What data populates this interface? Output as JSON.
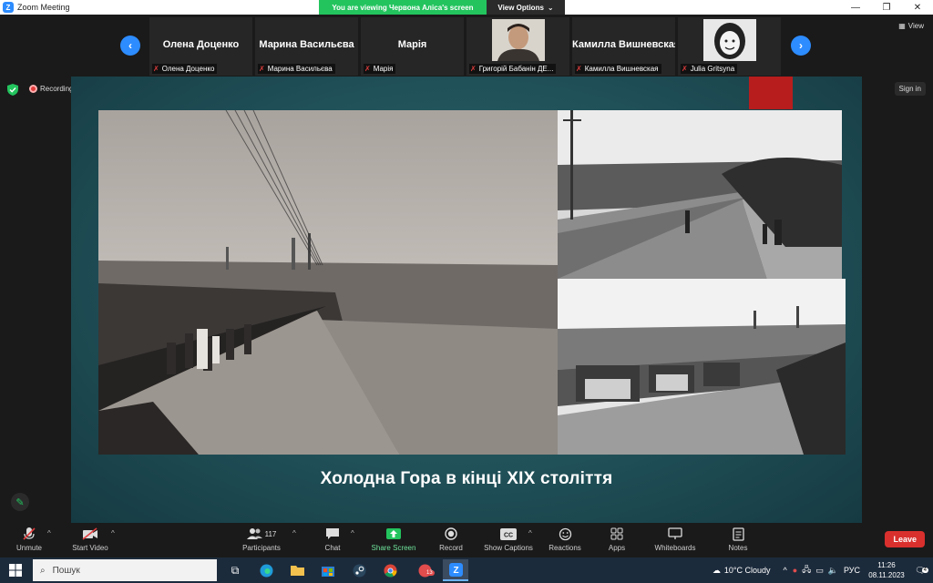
{
  "window": {
    "title": "Zoom Meeting",
    "minimize": "—",
    "maximize": "❐",
    "close": "✕"
  },
  "banner": {
    "viewing": "You are viewing Червона Аліса's screen",
    "view_options": "View Options"
  },
  "strip": {
    "prev": "‹",
    "next": "›",
    "view_label": "View",
    "tiles": [
      {
        "name": "Олена Доценко",
        "label": "Олена Доценко",
        "has_video": false
      },
      {
        "name": "Марина  Васильєва",
        "label": "Марина Васильєва",
        "has_video": false
      },
      {
        "name": "Марія",
        "label": "Марія",
        "has_video": false
      },
      {
        "name": "",
        "label": "Григорій Бабанін ДЕ...",
        "has_video": true
      },
      {
        "name": "Камилла  Вишневская",
        "label": "Камилла Вишневская",
        "has_video": false
      },
      {
        "name": "",
        "label": "Julia Gritsyna",
        "has_video": true
      }
    ]
  },
  "share": {
    "recording": "Recording",
    "sign_in": "Sign in"
  },
  "slide": {
    "caption": "Холодна Гора в кінці XIX століття"
  },
  "toolbar": {
    "unmute": "Unmute",
    "start_video": "Start Video",
    "participants": "Participants",
    "participants_count": "117",
    "chat": "Chat",
    "share_screen": "Share Screen",
    "record": "Record",
    "show_captions": "Show Captions",
    "reactions": "Reactions",
    "apps": "Apps",
    "whiteboards": "Whiteboards",
    "notes": "Notes",
    "leave": "Leave"
  },
  "taskbar": {
    "search_placeholder": "Пошук",
    "weather": "10°C  Cloudy",
    "lang": "РУС",
    "time": "11:26",
    "date": "08.11.2023",
    "notifications": "4",
    "badge": "13"
  },
  "colors": {
    "zoom_blue": "#2d8cff",
    "green": "#23c45e",
    "leave_red": "#d9302e",
    "slide_teal": "#2f6c72"
  }
}
